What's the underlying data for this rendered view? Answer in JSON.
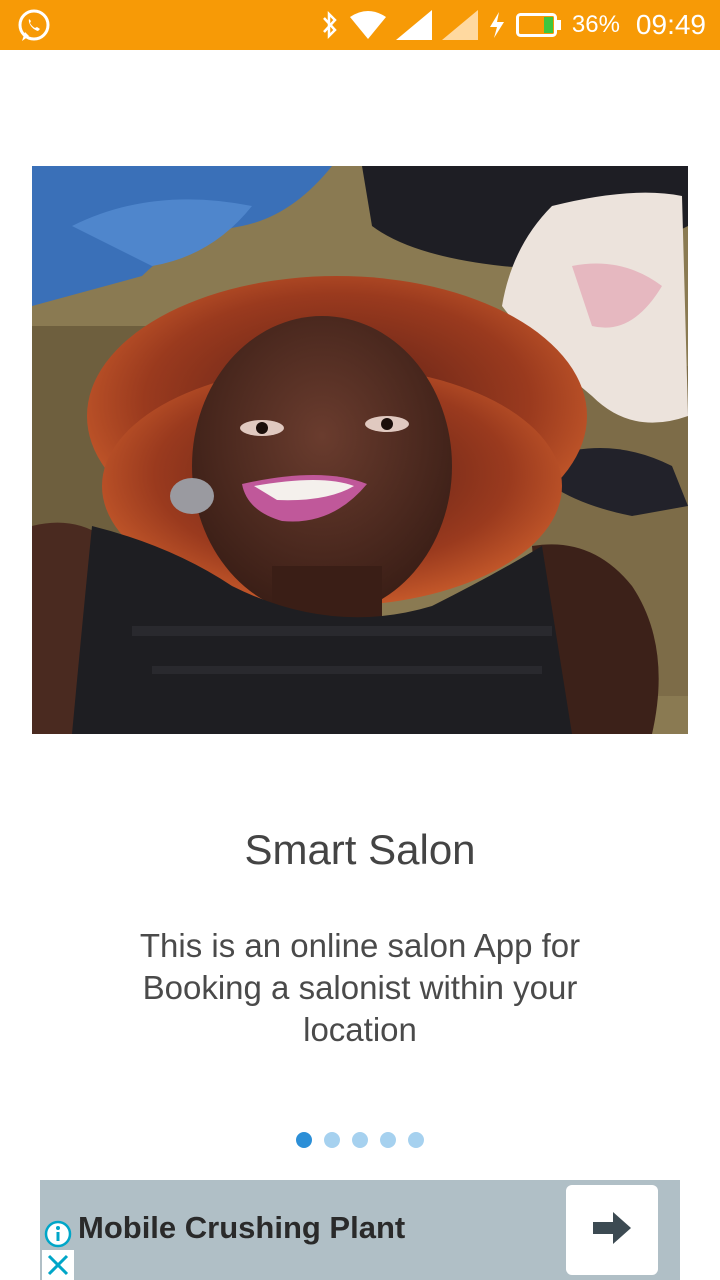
{
  "status_bar": {
    "battery_percent": "36%",
    "time": "09:49"
  },
  "slide": {
    "title": "Smart Salon",
    "description": "This is an online salon App for Booking a salonist within your location"
  },
  "pager": {
    "total": 5,
    "active_index": 0
  },
  "ad": {
    "title": "Mobile Crushing Plant"
  },
  "colors": {
    "status_bar": "#f79a06",
    "dot_active": "#2c8fd7",
    "dot_inactive": "#a6d1ef",
    "ad_background": "#b0bfc6",
    "ad_icon": "#00a6c8"
  }
}
